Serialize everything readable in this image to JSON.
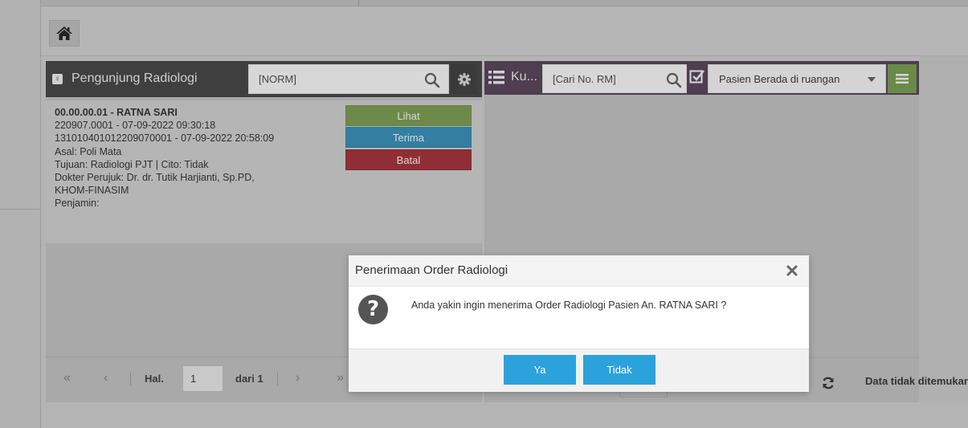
{
  "toolbar": {
    "home_icon": "home-icon"
  },
  "left_panel": {
    "title": "Pengunjung Radiologi",
    "search_placeholder": "[NORM]",
    "patient": {
      "line1": "00.00.00.01 - RATNA SARI",
      "line2": "220907.0001 - 07-09-2022 09:30:18",
      "line3": "131010401012209070001 - 07-09-2022 20:58:09",
      "line4": "Asal: Poli Mata",
      "line5": "Tujuan: Radiologi PJT | Cito: Tidak",
      "line6": "Dokter Perujuk: Dr. dr. Tutik Harjianti, Sp.PD,",
      "line7": "KHOM-FINASIM",
      "line8": "Penjamin:"
    },
    "actions": {
      "lihat": "Lihat",
      "terima": "Terima",
      "batal": "Batal"
    },
    "pager": {
      "first": "«",
      "prev": "‹",
      "hal_label": "Hal.",
      "page_value": "1",
      "of_label": "dari 1",
      "next": "›",
      "last": "»"
    }
  },
  "right_panel": {
    "title": "Ku...",
    "search_placeholder": "[Cari No. RM]",
    "filter_value": "Pasien Berada di ruangan",
    "status_text": "Data tidak ditemukan"
  },
  "modal": {
    "title": "Penerimaan Order Radiologi",
    "message": "Anda yakin ingin menerima Order Radiologi Pasien An. RATNA SARI ?",
    "yes_label": "Ya",
    "no_label": "Tidak"
  },
  "colors": {
    "left_header": "#3f3f3f",
    "right_header": "#4f3d50",
    "lihat": "#6e8a4a",
    "terima": "#337fa1",
    "batal": "#8f2e35",
    "modal_button": "#2ba2dc"
  }
}
